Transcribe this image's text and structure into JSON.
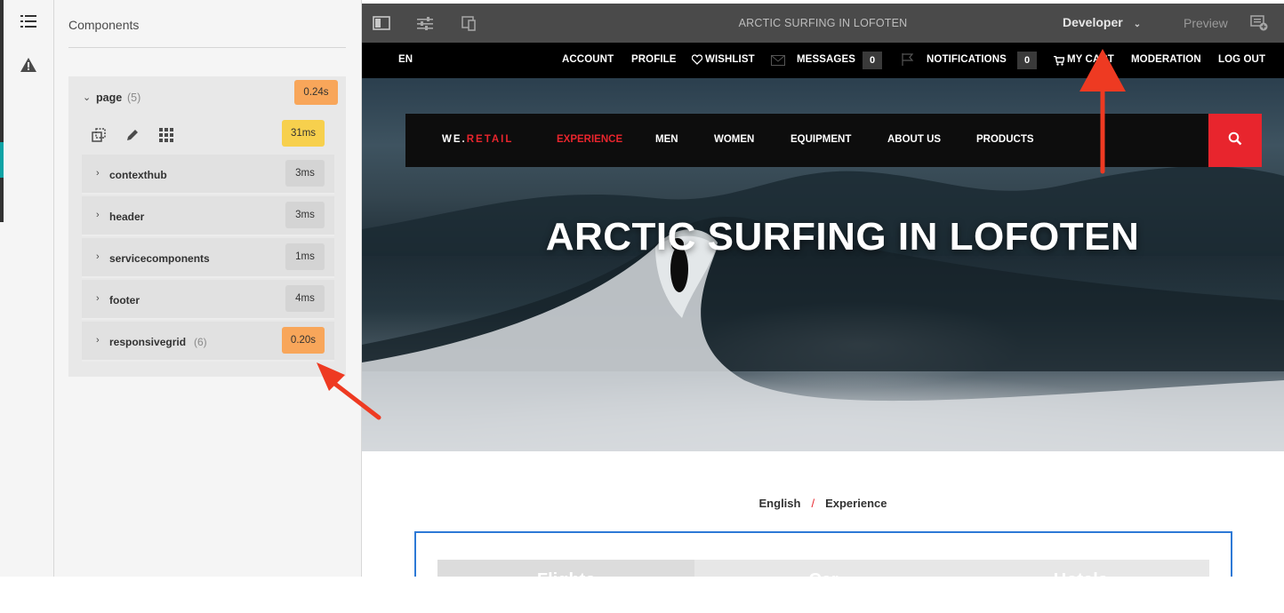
{
  "panel": {
    "title": "Components",
    "tree": {
      "root": {
        "label": "page",
        "count": "(5)",
        "timing": "0.24s",
        "tools_timing": "31ms"
      },
      "children": [
        {
          "label": "contexthub",
          "count": "",
          "timing": "3ms"
        },
        {
          "label": "header",
          "count": "",
          "timing": "3ms"
        },
        {
          "label": "servicecomponents",
          "count": "",
          "timing": "1ms"
        },
        {
          "label": "footer",
          "count": "",
          "timing": "4ms"
        },
        {
          "label": "responsivegrid",
          "count": "(6)",
          "timing": "0.20s"
        }
      ]
    }
  },
  "editor": {
    "page_title": "ARCTIC SURFING IN LOFOTEN",
    "mode": "Developer",
    "preview": "Preview"
  },
  "site": {
    "util": {
      "language": "EN",
      "account": "ACCOUNT",
      "profile": "PROFILE",
      "wishlist": "WISHLIST",
      "messages": "MESSAGES",
      "messages_count": "0",
      "notifications": "NOTIFICATIONS",
      "notifications_count": "0",
      "cart": "MY CART",
      "moderation": "MODERATION",
      "logout": "LOG OUT"
    },
    "brand": {
      "prefix": "WE.",
      "accent": "RETAIL"
    },
    "nav": {
      "experience": "EXPERIENCE",
      "men": "MEN",
      "women": "WOMEN",
      "equipment": "EQUIPMENT",
      "about": "ABOUT US",
      "products": "PRODUCTS"
    },
    "hero_title": "ARCTIC SURFING IN LOFOTEN",
    "breadcrumb": {
      "first": "English",
      "separator": "/",
      "second": "Experience"
    },
    "tabs": [
      "Flights",
      "Car",
      "Hotels"
    ]
  },
  "colors": {
    "accent_red": "#e8252d",
    "timing_orange": "#f8a65a",
    "timing_yellow": "#f7d04d",
    "selection_blue": "#2d79d6"
  }
}
